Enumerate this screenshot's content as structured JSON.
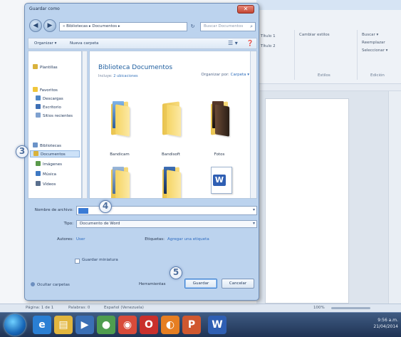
{
  "dialog": {
    "title": "Guardar como",
    "close_glyph": "✕",
    "back_glyph": "◀",
    "forward_glyph": "▶",
    "address": "« Bibliotecas ▸ Documentos ▸",
    "refresh_glyph": "↻",
    "search_placeholder": "Buscar Documentos",
    "toolbar": {
      "organize": "Organizar ▾",
      "new_folder": "Nueva carpeta",
      "views_glyph": "☰ ▾",
      "help_glyph": "❓"
    },
    "nav": {
      "items": [
        {
          "label": "Plantillas",
          "color": "#d9b23c"
        },
        {
          "label": "Favoritos",
          "color": "#f0c63b"
        },
        {
          "label": "Descargas",
          "color": "#4f86c6"
        },
        {
          "label": "Escritorio",
          "color": "#3e6fb5"
        },
        {
          "label": "Sitios recientes",
          "color": "#7fa1cf"
        },
        {
          "label": "Bibliotecas",
          "color": "#6b93c8"
        },
        {
          "label": "Documentos",
          "color": "#d9b23c"
        },
        {
          "label": "Imágenes",
          "color": "#5a9a4a"
        },
        {
          "label": "Música",
          "color": "#3e78c2"
        },
        {
          "label": "Vídeos",
          "color": "#5a6f8d"
        }
      ]
    },
    "library": {
      "title": "Biblioteca Documentos",
      "includes_label": "Incluye:",
      "includes_link": "2 ubicaciones",
      "arrange_label": "Organizar por:",
      "arrange_value": "Carpeta ▾"
    },
    "files": [
      {
        "label": "Bandicam"
      },
      {
        "label": "Bandisoft"
      },
      {
        "label": "Fotos"
      }
    ],
    "form": {
      "filename_label": "Nombre de archivo:",
      "filetype_label": "Tipo:",
      "filetype_value": "Documento de Word",
      "authors_label": "Autores:",
      "authors_value": "User",
      "tags_label": "Etiquetas:",
      "tags_value": "Agregar una etiqueta",
      "thumbnail_label": "Guardar miniatura",
      "hide_folders": "Ocultar carpetas",
      "tools_label": "Herramientas",
      "save_button": "Guardar",
      "cancel_button": "Cancelar",
      "dropdown_glyph": "▾"
    }
  },
  "callouts": [
    "3",
    "4",
    "5"
  ],
  "word": {
    "ribbon_labels": [
      "Estilos",
      "Edición"
    ],
    "ribbon_buttons": [
      "Buscar ▾",
      "Reemplazar",
      "Seleccionar ▾",
      "Cambiar estilos",
      "Título 1",
      "Título 2"
    ],
    "status": {
      "page": "Página: 1 de 1",
      "words": "Palabras: 0",
      "language": "Español (Venezuela)",
      "zoom": "100%"
    }
  },
  "taskbar": {
    "icons": [
      {
        "name": "ie",
        "glyph": "e",
        "color": "#2a7fd4"
      },
      {
        "name": "explorer",
        "glyph": "▤",
        "color": "#e2b63e"
      },
      {
        "name": "media",
        "glyph": "▶",
        "color": "#3a6fb5"
      },
      {
        "name": "app",
        "glyph": "●",
        "color": "#4f9d4f"
      },
      {
        "name": "chrome",
        "glyph": "◉",
        "color": "#d84b3a"
      },
      {
        "name": "opera",
        "glyph": "O",
        "color": "#c9302c"
      },
      {
        "name": "firefox",
        "glyph": "◐",
        "color": "#e67e22"
      },
      {
        "name": "powerpoint",
        "glyph": "P",
        "color": "#d0582f"
      },
      {
        "name": "word",
        "glyph": "W",
        "color": "#2f5fb3"
      }
    ],
    "tray_time": "9:56 a.m.",
    "tray_date": "21/04/2014"
  }
}
